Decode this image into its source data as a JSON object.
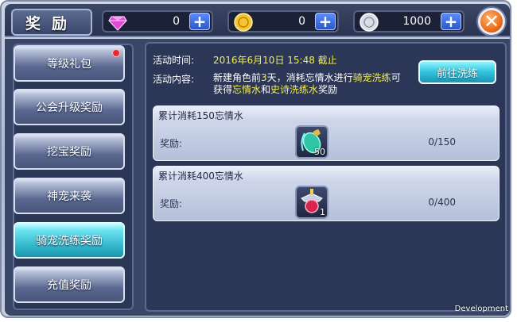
{
  "header": {
    "title": "奖励",
    "currencies": [
      {
        "name": "gem",
        "value": "0",
        "color": "#e04bd6"
      },
      {
        "name": "gold",
        "value": "0",
        "color": "#f7c531"
      },
      {
        "name": "silver",
        "value": "1000",
        "color": "#d9dde6"
      }
    ],
    "plus_label": "+",
    "close_label": "✕"
  },
  "sidebar": {
    "items": [
      {
        "label": "等级礼包",
        "has_badge": true
      },
      {
        "label": "公会升级奖励"
      },
      {
        "label": "挖宝奖励"
      },
      {
        "label": "神宠来袭"
      },
      {
        "label": "骑宠洗练奖励",
        "active": true
      },
      {
        "label": "充值奖励"
      }
    ]
  },
  "content": {
    "time_label": "活动时间:",
    "time_value": "2016年6月10日 15:48 截止",
    "desc_label": "活动内容:",
    "desc_text_1": "新建角色前",
    "desc_hl_1": "3",
    "desc_text_2": "天，消耗忘情水进行",
    "desc_hl_2": "骑宠洗练",
    "desc_text_3": "可获得",
    "desc_hl_3": "忘情水",
    "desc_text_4": "和",
    "desc_hl_4": "史诗洗练水",
    "desc_text_5": "奖励",
    "goto_button": "前往洗练",
    "tasks": [
      {
        "title": "累计消耗150忘情水",
        "reward_label": "奖励:",
        "item_count": "50",
        "progress": "0/150",
        "item_icon": "elixir-bottle-icon"
      },
      {
        "title": "累计消耗400忘情水",
        "reward_label": "奖励:",
        "item_count": "1",
        "progress": "0/400",
        "item_icon": "epic-potion-icon"
      }
    ]
  },
  "footer": {
    "dev_tag": "Development"
  }
}
